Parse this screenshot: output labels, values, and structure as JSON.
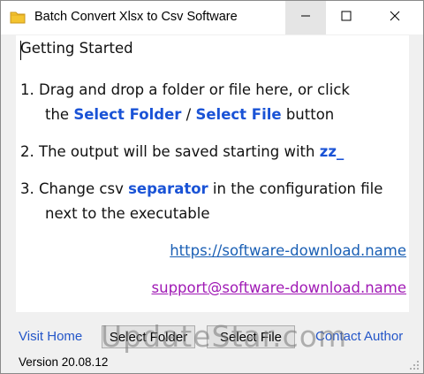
{
  "window": {
    "title": "Batch Convert Xlsx to Csv Software",
    "icons": {
      "app": "folder-icon",
      "minimize": "minimize-icon",
      "maximize": "maximize-icon",
      "close": "close-icon"
    }
  },
  "content": {
    "heading": "Getting Started",
    "step1": {
      "prefix": "1. Drag and drop a folder or file here, or click",
      "line2_pre": "the ",
      "select_folder": "Select Folder",
      "sep": " / ",
      "select_file": "Select File",
      "line2_post": " button"
    },
    "step2": {
      "text": "2. The output will be saved starting with ",
      "prefix_value": "zz_"
    },
    "step3": {
      "pre": "3. Change csv ",
      "separator": "separator",
      "post": " in the configuration file",
      "line2": "next to the executable"
    },
    "website_url": "https://software-download.name",
    "support_email": "support@software-download.name"
  },
  "bottombar": {
    "visit_home": "Visit Home",
    "select_folder_btn": "Select Folder",
    "select_file_btn": "Select File",
    "contact_author": "Contact Author"
  },
  "status": {
    "version": "Version 20.08.12"
  },
  "watermark": "UpdateStar.com",
  "colors": {
    "highlight": "#1a53d6",
    "url": "#1a5fb4",
    "email": "#a01ab5"
  }
}
